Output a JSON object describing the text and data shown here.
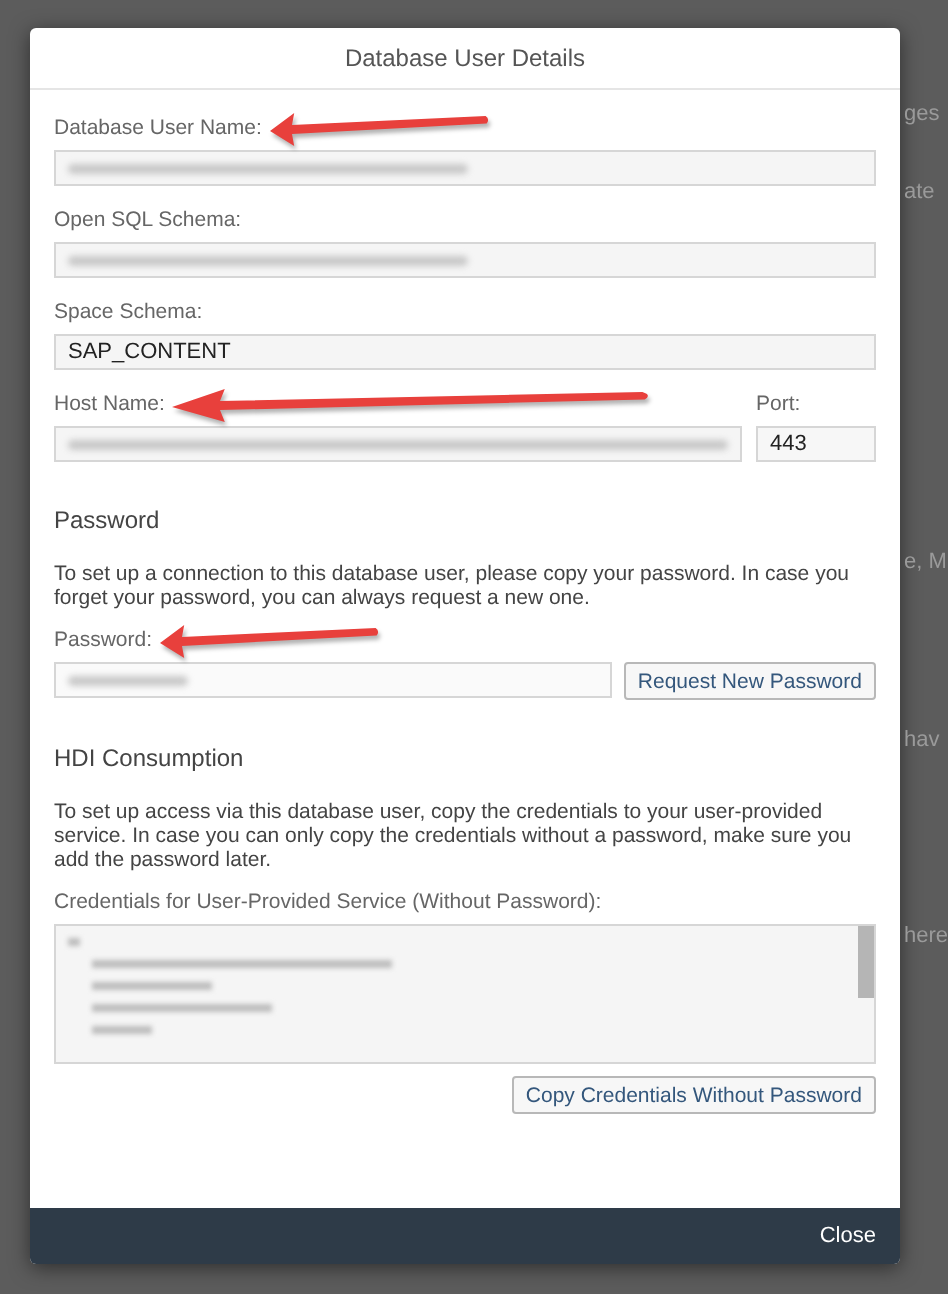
{
  "dialog": {
    "title": "Database User Details",
    "fields": [
      {
        "label": "Database User Name:",
        "redacted": true,
        "highlighted": true
      },
      {
        "label": "Open SQL Schema:",
        "redacted": true,
        "highlighted": false
      },
      {
        "label": "Space Schema:",
        "value": "SAP_CONTENT",
        "redacted": false,
        "highlighted": false
      }
    ],
    "host": {
      "label": "Host Name:",
      "redacted": true,
      "highlighted": true
    },
    "port": {
      "label": "Port:",
      "value": "443"
    },
    "password_section": {
      "heading": "Password",
      "text": "To set up a connection to this database user, please copy your password. In case you forget your password, you can always request a new one.",
      "field_label": "Password:",
      "redacted": true,
      "highlighted": true,
      "button": "Request New Password"
    },
    "hdi_section": {
      "heading": "HDI Consumption",
      "text": "To set up access via this database user, copy the credentials to your user-provided service. In case you can only copy the credentials without a password, make sure you add the password later.",
      "credentials_label": "Credentials for User-Provided Service (Without Password):",
      "redacted": true,
      "button": "Copy Credentials Without Password"
    },
    "footer_button": "Close"
  },
  "background_fragments": [
    "ges",
    "ate",
    "e, M",
    "hav",
    "here"
  ]
}
